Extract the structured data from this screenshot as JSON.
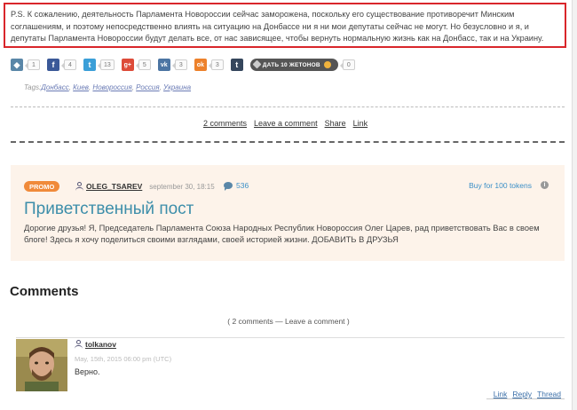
{
  "ps": {
    "text": "P.S. К сожалению, деятельность Парламента Новороссии сейчас заморожена, поскольку его существование противоречит Минским соглашениям, и поэтому непосредственно влиять на ситуацию на Донбассе ни я ни мои депутаты сейчас не могут. Но безусловно и я, и депутаты Парламента Новороссии будут делать все, от нас зависящее, чтобы вернуть нормальную жизнь как на Донбасс, так и на Украину."
  },
  "share": {
    "items": [
      {
        "icon": "tag-icon",
        "glyph": "◆",
        "color": "#5a87a8",
        "count": "1"
      },
      {
        "icon": "facebook-icon",
        "glyph": "f",
        "color": "#3b5998",
        "count": "4"
      },
      {
        "icon": "twitter-icon",
        "glyph": "t",
        "color": "#3b9fd8",
        "count": "13"
      },
      {
        "icon": "googleplus-icon",
        "glyph": "g+",
        "color": "#dd4b39",
        "count": "5"
      },
      {
        "icon": "vk-icon",
        "glyph": "vk",
        "color": "#4c75a3",
        "count": "3"
      },
      {
        "icon": "odnoklassniki-icon",
        "glyph": "ok",
        "color": "#ed812b",
        "count": "3"
      },
      {
        "icon": "tumblr-icon",
        "glyph": "t",
        "color": "#35465c",
        "count": null
      }
    ],
    "tokens_button": "ДАТЬ 10 ЖЕТОНОВ",
    "tokens_count": "0"
  },
  "tags": {
    "prefix": "Tags:",
    "items": [
      "Донбасс",
      "Киев",
      "Новороссия",
      "Россия",
      "Украина"
    ]
  },
  "actions": {
    "comments": "2 comments",
    "leave": "Leave a comment",
    "share": "Share",
    "link": "Link"
  },
  "promo": {
    "badge": "PROMO",
    "author": "OLEG_TSAREV",
    "date": "september 30, 18:15",
    "comments": "536",
    "buy": "Buy for 100 tokens",
    "info": "i",
    "title": "Приветственный пост",
    "text": "Дорогие друзья! Я, Председатель Парламента Союза Народных Республик Новороссия Олег Царев, рад приветствовать Вас в своем блоге! Здесь я хочу поделиться своими взглядами, своей историей жизни. ДОБАВИТЬ В ДРУЗЬЯ"
  },
  "comments_section": {
    "heading": "Comments",
    "summary": "( 2 comments — Leave a comment )"
  },
  "comment": {
    "author": "tolkanov",
    "date": "May, 15th, 2015 06:00 pm (UTC)",
    "text": "Верно.",
    "link": "Link",
    "reply": "Reply",
    "thread": "Thread"
  }
}
